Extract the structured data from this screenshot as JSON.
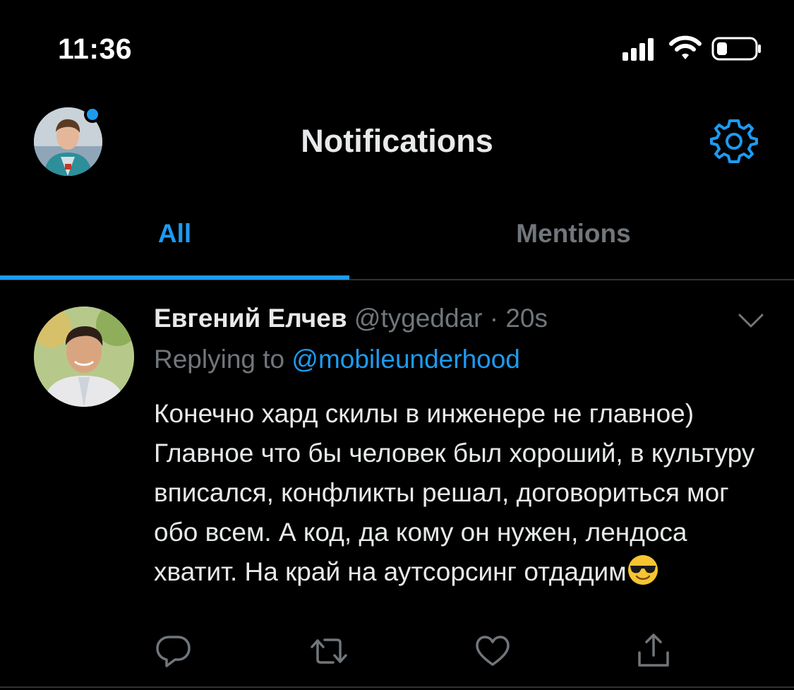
{
  "status_bar": {
    "time": "11:36"
  },
  "header": {
    "title": "Notifications"
  },
  "tabs": [
    {
      "label": "All",
      "active": true
    },
    {
      "label": "Mentions",
      "active": false
    }
  ],
  "tweet": {
    "author_name": "Евгений Елчев",
    "author_handle": "@tygeddar",
    "separator": "·",
    "time": "20s",
    "replying_prefix": "Replying to",
    "replying_handle": "@mobileunderhood",
    "text": "Конечно хард скилы в инженере не главное) Главное что бы человек был хороший, в культуру вписался, конфликты решал, договориться мог обо всем. А код, да кому он нужен, лендоса хватит. На край на аутсорсинг отдадим",
    "emoji": "smiling-face-with-sunglasses"
  },
  "colors": {
    "background": "#000000",
    "accent": "#1d9bf0",
    "text_primary": "#e7e9ea",
    "text_secondary": "#71767b",
    "divider": "#2f3336"
  }
}
